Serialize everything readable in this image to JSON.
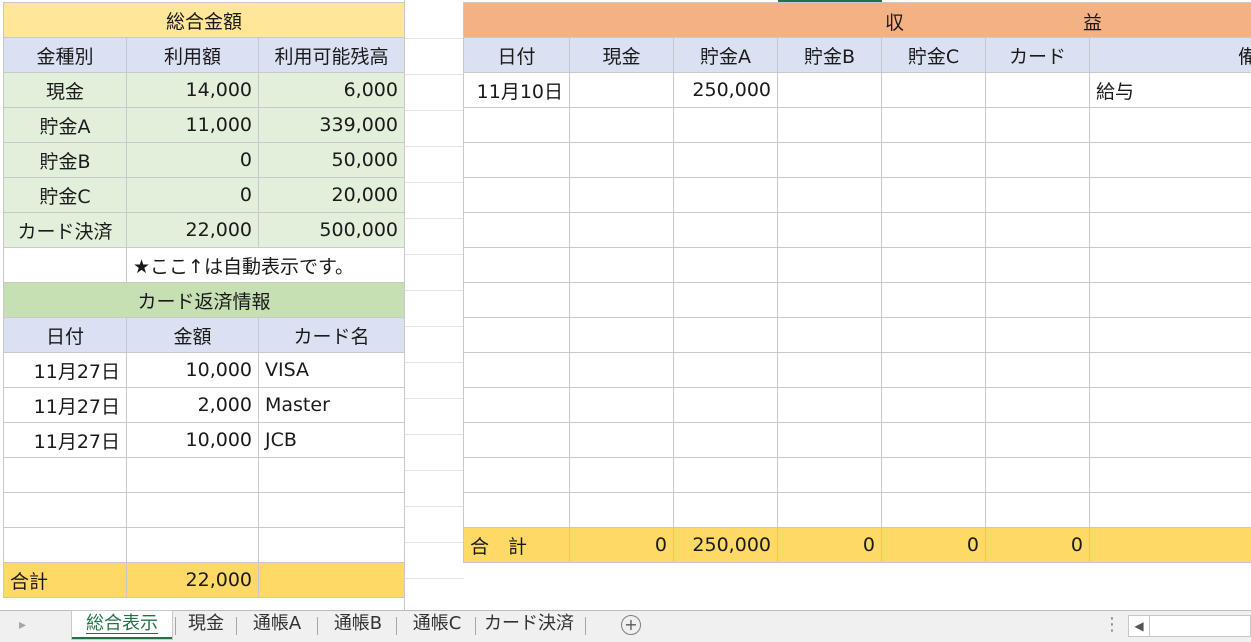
{
  "summary": {
    "title": "総合金額",
    "headers": [
      "金種別",
      "利用額",
      "利用可能残高"
    ],
    "rows": [
      {
        "name": "現金",
        "used": "14,000",
        "remaining": "6,000"
      },
      {
        "name": "貯金A",
        "used": "11,000",
        "remaining": "339,000"
      },
      {
        "name": "貯金B",
        "used": "0",
        "remaining": "50,000"
      },
      {
        "name": "貯金C",
        "used": "0",
        "remaining": "20,000"
      },
      {
        "name": "カード決済",
        "used": "22,000",
        "remaining": "500,000"
      }
    ],
    "note": "★ここ↑は自動表示です。"
  },
  "card_repayment": {
    "title": "カード返済情報",
    "headers": [
      "日付",
      "金額",
      "カード名"
    ],
    "rows": [
      {
        "date": "11月27日",
        "amount": "10,000",
        "card": "VISA"
      },
      {
        "date": "11月27日",
        "amount": "2,000",
        "card": "Master"
      },
      {
        "date": "11月27日",
        "amount": "10,000",
        "card": "JCB"
      }
    ],
    "total_label": "合計",
    "total_amount": "22,000"
  },
  "income": {
    "title_part1": "収",
    "title_part2": "益",
    "headers": [
      "日付",
      "現金",
      "貯金A",
      "貯金B",
      "貯金C",
      "カード",
      "備"
    ],
    "rows": [
      {
        "date": "11月10日",
        "cash": "",
        "saving_a": "250,000",
        "saving_b": "",
        "saving_c": "",
        "card": "",
        "note": "給与"
      }
    ],
    "total_label": "合　計",
    "totals": [
      "0",
      "250,000",
      "0",
      "0",
      "0"
    ]
  },
  "tabs": [
    "総合表示",
    "現金",
    "通帳A",
    "通帳B",
    "通帳C",
    "カード決済"
  ],
  "active_tab": "総合表示",
  "icons": {
    "add_sheet": "plus-circle-icon",
    "scroll_left": "triangle-left-icon",
    "options": "vertical-dots-icon"
  }
}
